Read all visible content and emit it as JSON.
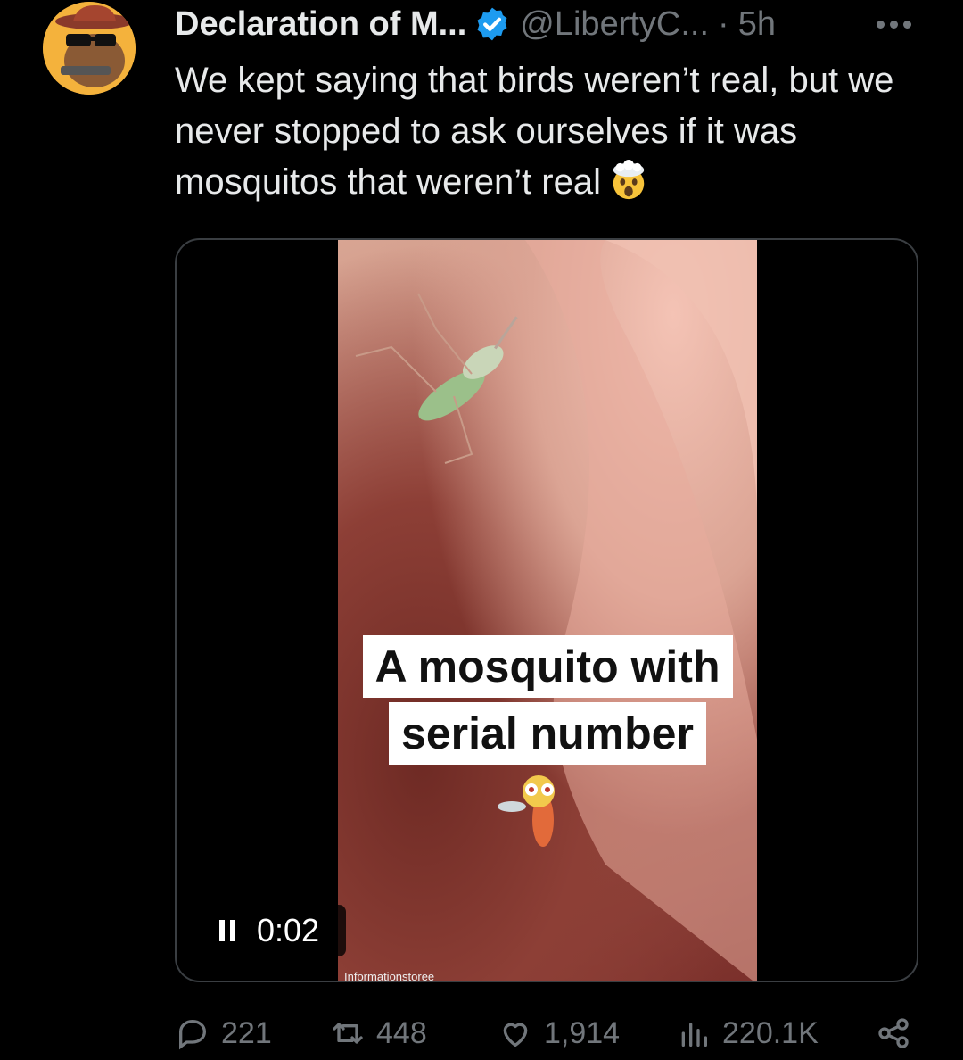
{
  "author": {
    "display_name": "Declaration of M...",
    "handle": "@LibertyC...",
    "separator": "·",
    "time": "5h",
    "verified": true
  },
  "tweet": {
    "text": "We kept saying that birds weren’t real, but we never stopped to ask ourselves if it was mosquitos that weren’t real",
    "emoji": "exploding-head"
  },
  "video": {
    "caption_line1": "A mosquito with",
    "caption_line2": "serial number",
    "watermark": "Informationstoree",
    "elapsed": "0:02",
    "state": "playing"
  },
  "actions": {
    "replies": "221",
    "reposts": "448",
    "likes": "1,914",
    "views": "220.1K"
  },
  "colors": {
    "background": "#000000",
    "text": "#e7e9ea",
    "muted": "#71767b",
    "verified": "#1d9bf0"
  }
}
